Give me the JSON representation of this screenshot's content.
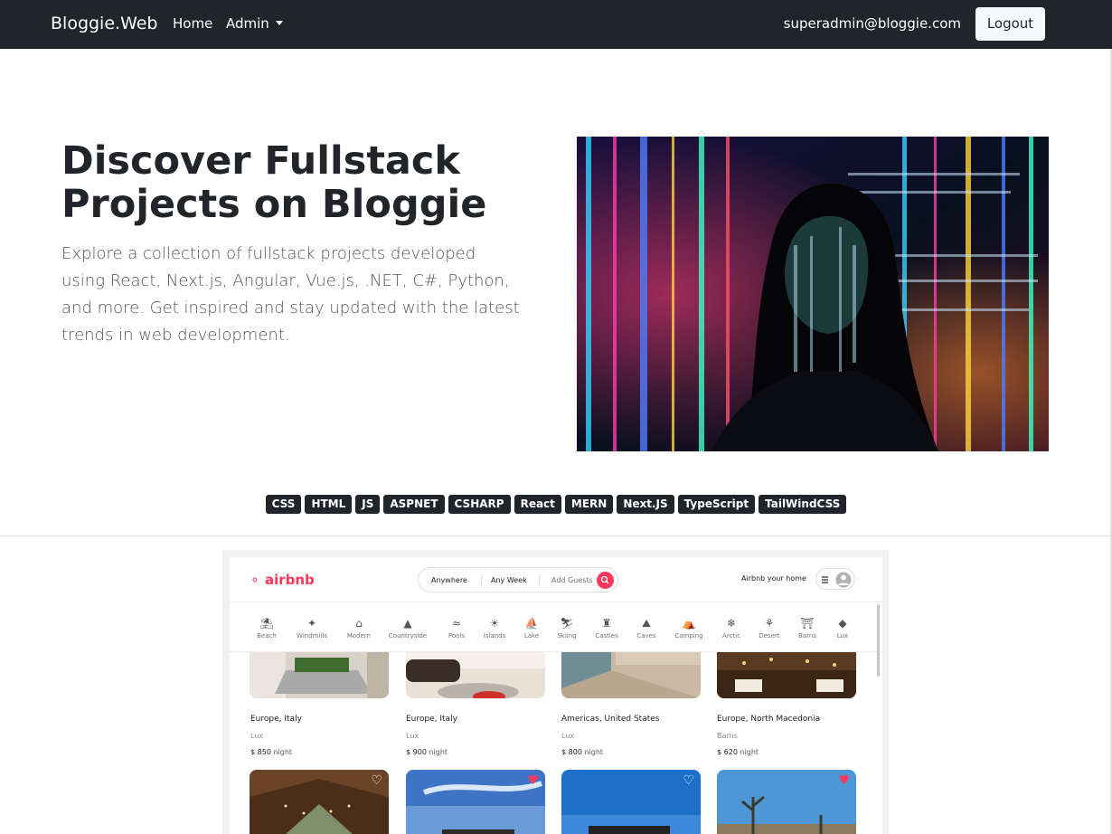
{
  "navbar": {
    "brand": "Bloggie.Web",
    "home": "Home",
    "admin": "Admin",
    "user_email": "superadmin@bloggie.com",
    "logout": "Logout"
  },
  "hero": {
    "title": "Discover Fullstack Projects on Bloggie",
    "description": "Explore a collection of fullstack projects developed using React, Next.js, Angular, Vue.js, .NET, C#, Python, and more. Get inspired and stay updated with the latest trends in web development."
  },
  "tags": [
    "CSS",
    "HTML",
    "JS",
    "ASPNET",
    "CSHARP",
    "React",
    "MERN",
    "Next.JS",
    "TypeScript",
    "TailWindCSS"
  ],
  "airbnb_preview": {
    "logo": "airbnb",
    "search": {
      "where": "Anywhere",
      "when": "Any Week",
      "guests": "Add Guests"
    },
    "host_link": "Airbnb your home",
    "categories": [
      {
        "label": "Beach",
        "icon": "beach-icon"
      },
      {
        "label": "Windmills",
        "icon": "windmill-icon"
      },
      {
        "label": "Modern",
        "icon": "modern-house-icon"
      },
      {
        "label": "Countryside",
        "icon": "mountain-icon"
      },
      {
        "label": "Pools",
        "icon": "pool-icon"
      },
      {
        "label": "Islands",
        "icon": "island-icon"
      },
      {
        "label": "Lake",
        "icon": "lake-icon"
      },
      {
        "label": "Skiing",
        "icon": "skiing-icon"
      },
      {
        "label": "Castles",
        "icon": "castle-icon"
      },
      {
        "label": "Caves",
        "icon": "cave-icon"
      },
      {
        "label": "Camping",
        "icon": "camping-icon"
      },
      {
        "label": "Arctic",
        "icon": "snowflake-icon"
      },
      {
        "label": "Desert",
        "icon": "cactus-icon"
      },
      {
        "label": "Barns",
        "icon": "barn-icon"
      },
      {
        "label": "Lux",
        "icon": "diamond-icon"
      }
    ],
    "listings": [
      {
        "location": "Europe, Italy",
        "category": "Lux",
        "price": "$ 850",
        "unit": "night"
      },
      {
        "location": "Europe, Italy",
        "category": "Lux",
        "price": "$ 900",
        "unit": "night"
      },
      {
        "location": "Americas, United States",
        "category": "Lux",
        "price": "$ 800",
        "unit": "night"
      },
      {
        "location": "Europe, North Macedonia",
        "category": "Barns",
        "price": "$ 620",
        "unit": "night"
      }
    ],
    "colors": {
      "accent": "#ff385c"
    }
  },
  "colors": {
    "navbar_bg": "#212529",
    "tag_bg": "#212529"
  }
}
